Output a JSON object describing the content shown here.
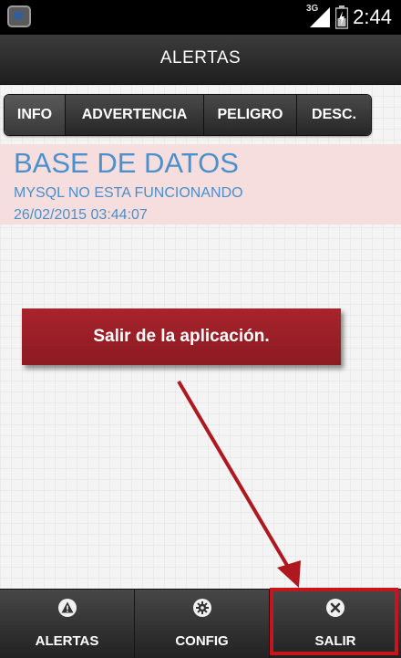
{
  "status_bar": {
    "network": "3G",
    "time": "2:44"
  },
  "action_bar": {
    "title": "ALERTAS"
  },
  "tabs": [
    {
      "label": "INFO"
    },
    {
      "label": "ADVERTENCIA"
    },
    {
      "label": "PELIGRO"
    },
    {
      "label": "DESC."
    }
  ],
  "alert": {
    "title": "BASE DE DATOS",
    "message": "MYSQL NO ESTA FUNCIONANDO",
    "timestamp": "26/02/2015 03:44:07",
    "background_color": "#f6dede",
    "text_color": "#4a90cc"
  },
  "annotation": {
    "text": "Salir de la aplicación.",
    "color": "#a01f27"
  },
  "bottom_nav": [
    {
      "label": "ALERTAS",
      "icon": "warning-icon"
    },
    {
      "label": "CONFIG",
      "icon": "gear-icon"
    },
    {
      "label": "SALIR",
      "icon": "close-icon"
    }
  ],
  "highlight_color": "#c8141b"
}
